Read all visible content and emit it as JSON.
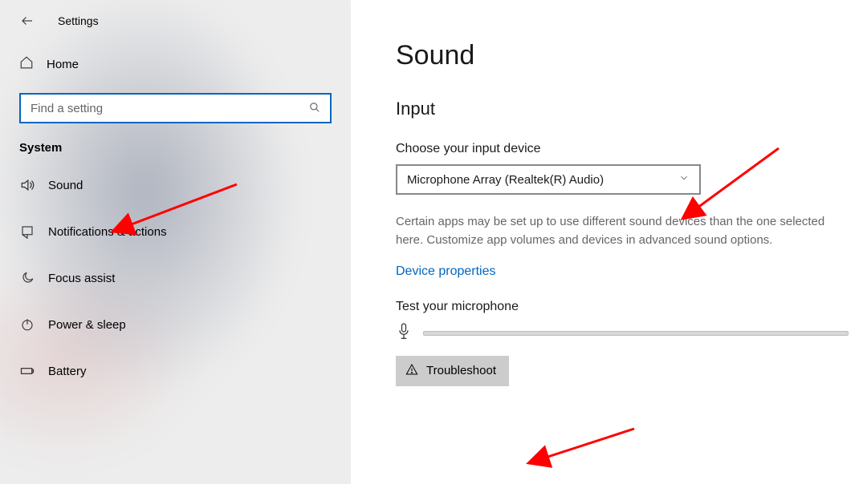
{
  "app_title": "Settings",
  "sidebar": {
    "home_label": "Home",
    "search_placeholder": "Find a setting",
    "section_label": "System",
    "items": [
      {
        "label": "Sound"
      },
      {
        "label": "Notifications & actions"
      },
      {
        "label": "Focus assist"
      },
      {
        "label": "Power & sleep"
      },
      {
        "label": "Battery"
      }
    ]
  },
  "main": {
    "title": "Sound",
    "input_heading": "Input",
    "choose_label": "Choose your input device",
    "selected_device": "Microphone Array (Realtek(R) Audio)",
    "help_text": "Certain apps may be set up to use different sound devices than the one selected here. Customize app volumes and devices in advanced sound options.",
    "device_props_link": "Device properties",
    "test_label": "Test your microphone",
    "troubleshoot_label": "Troubleshoot"
  },
  "colors": {
    "accent": "#0067c0",
    "annotation": "#ff0000"
  }
}
